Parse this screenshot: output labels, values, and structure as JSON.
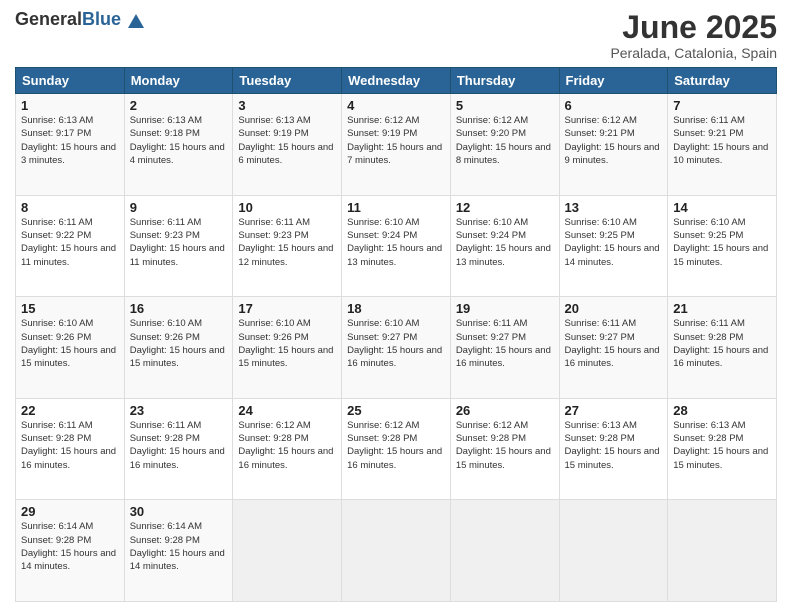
{
  "logo": {
    "general": "General",
    "blue": "Blue"
  },
  "header": {
    "title": "June 2025",
    "subtitle": "Peralada, Catalonia, Spain"
  },
  "columns": [
    "Sunday",
    "Monday",
    "Tuesday",
    "Wednesday",
    "Thursday",
    "Friday",
    "Saturday"
  ],
  "weeks": [
    [
      {
        "day": 1,
        "sunrise": "6:13 AM",
        "sunset": "9:17 PM",
        "daylight": "15 hours and 3 minutes."
      },
      {
        "day": 2,
        "sunrise": "6:13 AM",
        "sunset": "9:18 PM",
        "daylight": "15 hours and 4 minutes."
      },
      {
        "day": 3,
        "sunrise": "6:13 AM",
        "sunset": "9:19 PM",
        "daylight": "15 hours and 6 minutes."
      },
      {
        "day": 4,
        "sunrise": "6:12 AM",
        "sunset": "9:19 PM",
        "daylight": "15 hours and 7 minutes."
      },
      {
        "day": 5,
        "sunrise": "6:12 AM",
        "sunset": "9:20 PM",
        "daylight": "15 hours and 8 minutes."
      },
      {
        "day": 6,
        "sunrise": "6:12 AM",
        "sunset": "9:21 PM",
        "daylight": "15 hours and 9 minutes."
      },
      {
        "day": 7,
        "sunrise": "6:11 AM",
        "sunset": "9:21 PM",
        "daylight": "15 hours and 10 minutes."
      }
    ],
    [
      {
        "day": 8,
        "sunrise": "6:11 AM",
        "sunset": "9:22 PM",
        "daylight": "15 hours and 11 minutes."
      },
      {
        "day": 9,
        "sunrise": "6:11 AM",
        "sunset": "9:23 PM",
        "daylight": "15 hours and 11 minutes."
      },
      {
        "day": 10,
        "sunrise": "6:11 AM",
        "sunset": "9:23 PM",
        "daylight": "15 hours and 12 minutes."
      },
      {
        "day": 11,
        "sunrise": "6:10 AM",
        "sunset": "9:24 PM",
        "daylight": "15 hours and 13 minutes."
      },
      {
        "day": 12,
        "sunrise": "6:10 AM",
        "sunset": "9:24 PM",
        "daylight": "15 hours and 13 minutes."
      },
      {
        "day": 13,
        "sunrise": "6:10 AM",
        "sunset": "9:25 PM",
        "daylight": "15 hours and 14 minutes."
      },
      {
        "day": 14,
        "sunrise": "6:10 AM",
        "sunset": "9:25 PM",
        "daylight": "15 hours and 15 minutes."
      }
    ],
    [
      {
        "day": 15,
        "sunrise": "6:10 AM",
        "sunset": "9:26 PM",
        "daylight": "15 hours and 15 minutes."
      },
      {
        "day": 16,
        "sunrise": "6:10 AM",
        "sunset": "9:26 PM",
        "daylight": "15 hours and 15 minutes."
      },
      {
        "day": 17,
        "sunrise": "6:10 AM",
        "sunset": "9:26 PM",
        "daylight": "15 hours and 15 minutes."
      },
      {
        "day": 18,
        "sunrise": "6:10 AM",
        "sunset": "9:27 PM",
        "daylight": "15 hours and 16 minutes."
      },
      {
        "day": 19,
        "sunrise": "6:11 AM",
        "sunset": "9:27 PM",
        "daylight": "15 hours and 16 minutes."
      },
      {
        "day": 20,
        "sunrise": "6:11 AM",
        "sunset": "9:27 PM",
        "daylight": "15 hours and 16 minutes."
      },
      {
        "day": 21,
        "sunrise": "6:11 AM",
        "sunset": "9:28 PM",
        "daylight": "15 hours and 16 minutes."
      }
    ],
    [
      {
        "day": 22,
        "sunrise": "6:11 AM",
        "sunset": "9:28 PM",
        "daylight": "15 hours and 16 minutes."
      },
      {
        "day": 23,
        "sunrise": "6:11 AM",
        "sunset": "9:28 PM",
        "daylight": "15 hours and 16 minutes."
      },
      {
        "day": 24,
        "sunrise": "6:12 AM",
        "sunset": "9:28 PM",
        "daylight": "15 hours and 16 minutes."
      },
      {
        "day": 25,
        "sunrise": "6:12 AM",
        "sunset": "9:28 PM",
        "daylight": "15 hours and 16 minutes."
      },
      {
        "day": 26,
        "sunrise": "6:12 AM",
        "sunset": "9:28 PM",
        "daylight": "15 hours and 15 minutes."
      },
      {
        "day": 27,
        "sunrise": "6:13 AM",
        "sunset": "9:28 PM",
        "daylight": "15 hours and 15 minutes."
      },
      {
        "day": 28,
        "sunrise": "6:13 AM",
        "sunset": "9:28 PM",
        "daylight": "15 hours and 15 minutes."
      }
    ],
    [
      {
        "day": 29,
        "sunrise": "6:14 AM",
        "sunset": "9:28 PM",
        "daylight": "15 hours and 14 minutes."
      },
      {
        "day": 30,
        "sunrise": "6:14 AM",
        "sunset": "9:28 PM",
        "daylight": "15 hours and 14 minutes."
      },
      null,
      null,
      null,
      null,
      null
    ]
  ],
  "labels": {
    "sunrise": "Sunrise:",
    "sunset": "Sunset:",
    "daylight": "Daylight:"
  }
}
